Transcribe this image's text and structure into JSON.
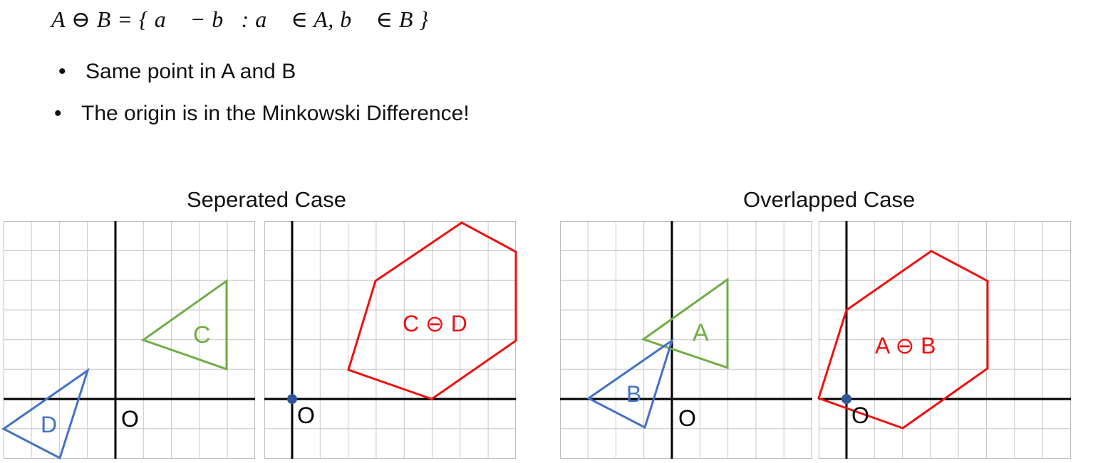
{
  "formula": "A ⊖ B = { a⃗ − b⃗: a⃗ ∈ A, b⃗ ∈ B }",
  "bullets": [
    {
      "marker": "•",
      "text": "Same point in A and B"
    },
    {
      "marker": "•",
      "text": "The origin is in the Minkowski Difference!"
    }
  ],
  "cases": [
    {
      "title": "Seperated Case"
    },
    {
      "title": "Overlapped Case"
    }
  ],
  "panels": [
    {
      "origin_label": "O",
      "shapes": [
        {
          "label": "C",
          "color": "#70ad47"
        },
        {
          "label": "D",
          "color": "#4472c4"
        }
      ]
    },
    {
      "origin_label": "O",
      "shapes": [
        {
          "label": "C ⊖ D",
          "color": "#ee1111"
        }
      ]
    },
    {
      "origin_label": "O",
      "shapes": [
        {
          "label": "A",
          "color": "#70ad47"
        },
        {
          "label": "B",
          "color": "#4472c4"
        }
      ]
    },
    {
      "origin_label": "O",
      "shapes": [
        {
          "label": "A ⊖ B",
          "color": "#ee1111"
        }
      ]
    }
  ],
  "colors": {
    "axis": "#000000",
    "grid": "#c8c8c8",
    "origin_dot": "#2f5597"
  }
}
